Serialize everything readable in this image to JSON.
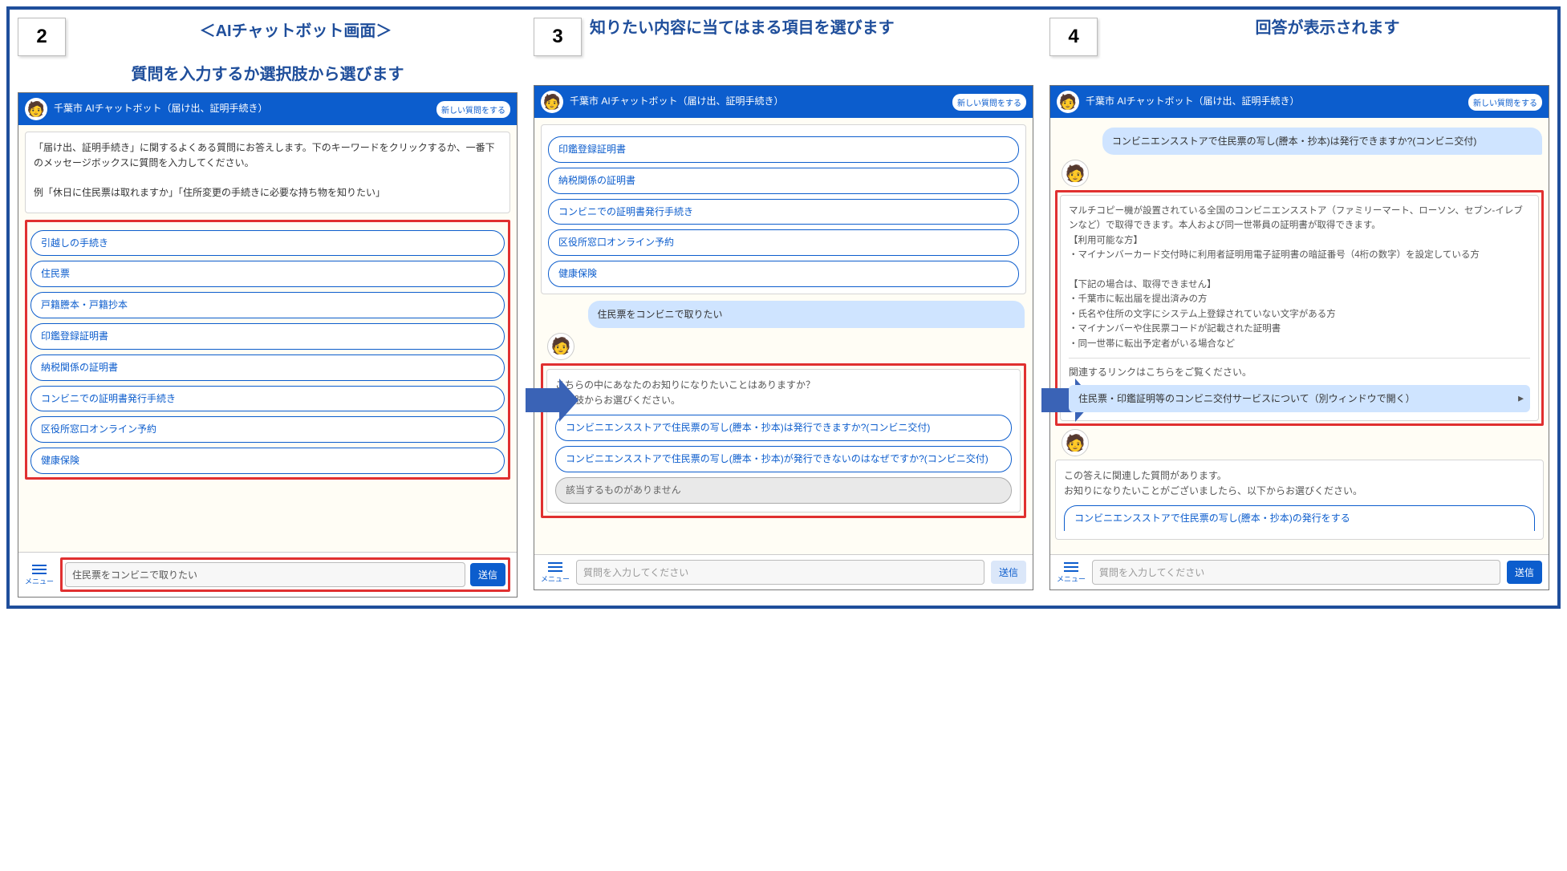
{
  "steps": {
    "s2": {
      "num": "2",
      "screenTitle": "＜AIチャットボット画面＞",
      "caption": "質問を入力するか選択肢から選びます"
    },
    "s3": {
      "num": "3",
      "caption": "知りたい内容に当てはまる項目を選びます"
    },
    "s4": {
      "num": "4",
      "caption": "回答が表示されます"
    }
  },
  "phone": {
    "headerTitle": "千葉市 AIチャットボット（届け出、証明手続き）",
    "newQuestion": "新しい質問をする",
    "menuLabel": "メニュー",
    "sendLabel": "送信",
    "placeholder": "質問を入力してください"
  },
  "p2": {
    "intro1": "「届け出、証明手続き」に関するよくある質問にお答えします。下のキーワードをクリックするか、一番下のメッセージボックスに質問を入力してください。",
    "intro2": "例「休日に住民票は取れますか」「住所変更の手続きに必要な持ち物を知りたい」",
    "options": [
      "引越しの手続き",
      "住民票",
      "戸籍謄本・戸籍抄本",
      "印鑑登録証明書",
      "納税関係の証明書",
      "コンビニでの証明書発行手続き",
      "区役所窓口オンライン予約",
      "健康保険"
    ],
    "inputValue": "住民票をコンビニで取りたい"
  },
  "p3": {
    "prevOptions": [
      "印鑑登録証明書",
      "納税関係の証明書",
      "コンビニでの証明書発行手続き",
      "区役所窓口オンライン予約",
      "健康保険"
    ],
    "userMsg": "住民票をコンビニで取りたい",
    "botPrompt": "こちらの中にあなたのお知りになりたいことはありますか？\n選択肢からお選びください。",
    "opts": [
      "コンビニエンスストアで住民票の写し(謄本・抄本)は発行できますか?(コンビニ交付)",
      "コンビニエンスストアで住民票の写し(謄本・抄本)が発行できないのはなぜですか?(コンビニ交付)",
      "該当するものがありません"
    ]
  },
  "p4": {
    "userMsg": "コンビニエンスストアで住民票の写し(謄本・抄本)は発行できますか?(コンビニ交付)",
    "answer": "マルチコピー機が設置されている全国のコンビニエンスストア（ファミリーマート、ローソン、セブン-イレブンなど）で取得できます。本人および同一世帯員の証明書が取得できます。\n【利用可能な方】\n・マイナンバーカード交付時に利用者証明用電子証明書の暗証番号（4桁の数字）を設定している方\n\n【下記の場合は、取得できません】\n・千葉市に転出届を提出済みの方\n・氏名や住所の文字にシステム上登録されていない文字がある方\n・マイナンバーや住民票コードが記載された証明書\n・同一世帯に転出予定者がいる場合など",
    "relLinkLabel": "関連するリンクはこちらをご覧ください。",
    "link": "住民票・印鑑証明等のコンビニ交付サービスについて（別ウィンドウで開く）",
    "followIntro": "この答えに関連した質問があります。\nお知りになりたいことがございましたら、以下からお選びください。",
    "followOpt": "コンビニエンスストアで住民票の写し(謄本・抄本)の発行をする"
  }
}
